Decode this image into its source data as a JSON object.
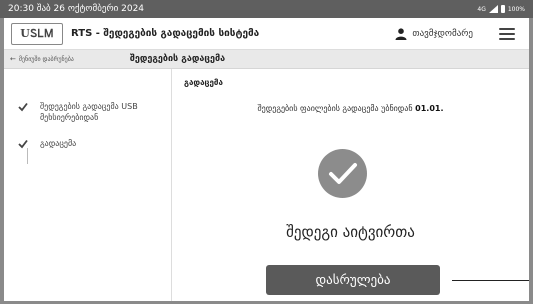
{
  "status_bar": {
    "time": "20:30 შაბ 26 ოქტომბერი 2024",
    "network": "4G",
    "battery": "100%"
  },
  "header": {
    "logo_text": "UᏚᏞᎷ",
    "title": "RTS - შედეგების გადაცემის სისტემა",
    "user_name": "თავმჯდომარე",
    "user_icon": "user-icon",
    "menu_icon": "menu-icon"
  },
  "breadcrumb": {
    "back_icon": "arrow-left-icon",
    "back_label": "მენიუში დაბრუნება",
    "current": "შედეგების გადაცემა"
  },
  "sidebar": {
    "steps": [
      {
        "label": "შედეგების გადაცემა USB მეხსიერებიდან",
        "done": true
      },
      {
        "label": "გადაცემა",
        "done": true
      }
    ]
  },
  "content": {
    "title": "გადაცემა",
    "message_prefix": "შედეგების ფაილების გადაცემა უბნიდან",
    "message_value": "01.01.",
    "result": "შედეგი აიტვირთა",
    "finish_button": "დასრულება"
  },
  "colors": {
    "status_bar": "#5f5f5f",
    "primary_button": "#5a5a5a",
    "check_circle": "#8c8c8c",
    "breadcrumb_bg": "#e9e9e9"
  }
}
